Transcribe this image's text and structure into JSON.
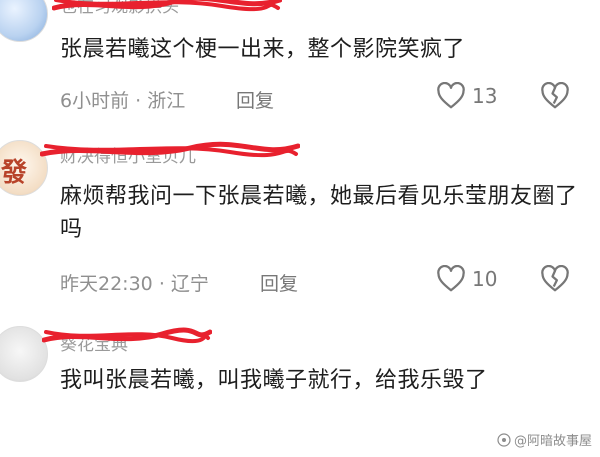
{
  "colors": {
    "scribble": "#e8212e",
    "meta": "#8f8f8f",
    "text": "#1e1e1e"
  },
  "comments": [
    {
      "username": "也在习观影拱头",
      "text": "张晨若曦这个梗一出来，整个影院笑疯了",
      "time": "6小时前",
      "location": "浙江",
      "reply_label": "回复",
      "likes": "13"
    },
    {
      "username": "财决得恒小室贝儿",
      "text": "麻烦帮我问一下张晨若曦，她最后看见乐莹朋友圈了吗",
      "time": "昨天22:30",
      "location": "辽宁",
      "reply_label": "回复",
      "likes": "10"
    },
    {
      "username": "葵花宝典",
      "text": "我叫张晨若曦，叫我曦子就行，给我乐毁了"
    }
  ],
  "watermark": "@阿暗故事屋",
  "icons": {
    "like": "heart-outline-icon",
    "dislike": "broken-heart-icon",
    "watermark": "weibo-logo-icon"
  }
}
